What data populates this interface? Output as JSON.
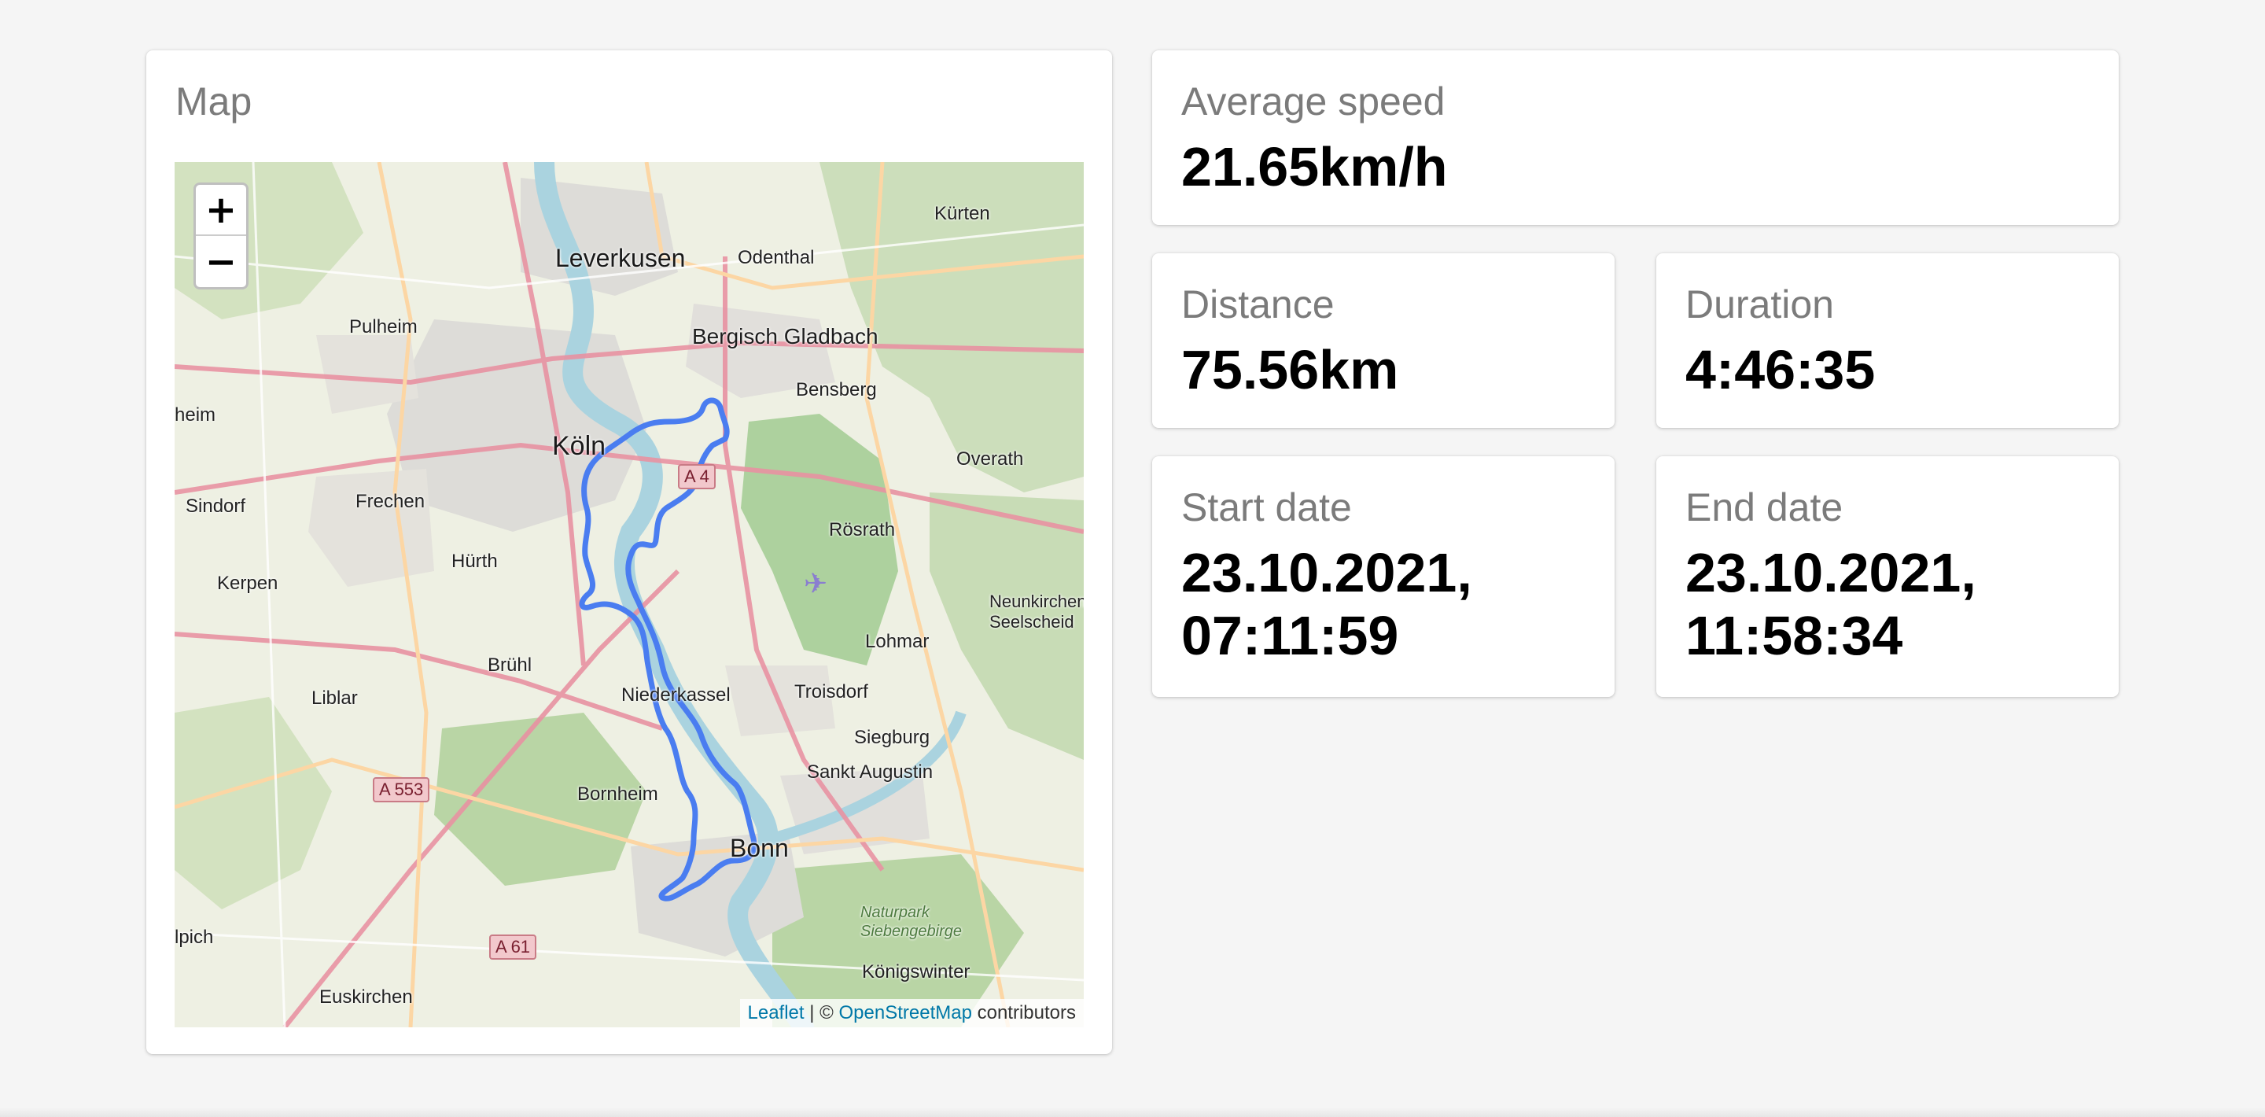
{
  "map_card": {
    "title": "Map",
    "zoom_in": "+",
    "zoom_out": "−",
    "attribution": {
      "leaflet": "Leaflet",
      "separator": " | © ",
      "osm": "OpenStreetMap",
      "suffix": " contributors"
    },
    "place_labels": [
      "Leverkusen",
      "Odenthal",
      "Kürten",
      "Bergisch Gladbach",
      "Pulheim",
      "Bensberg",
      "Köln",
      "Overath",
      "Sindorf",
      "Frechen",
      "Rösrath",
      "Hürth",
      "Kerpen",
      "Neunkirchen-Seelscheid",
      "Lohmar",
      "Brühl",
      "Niederkassel",
      "Troisdorf",
      "Liblar",
      "Siegburg",
      "Sankt Augustin",
      "Bornheim",
      "Bonn",
      "Naturpark Siebengebirge",
      "Königswinter",
      "Euskirchen",
      "heim",
      "lpich"
    ],
    "road_shields": [
      "A 4",
      "A 553",
      "A 61"
    ],
    "colors": {
      "route": "#4a7df0",
      "water": "#aad3df",
      "forest": "#add19e",
      "urban": "#dddcd8"
    }
  },
  "stats": {
    "average_speed": {
      "label": "Average speed",
      "value": "21.65km/h"
    },
    "distance": {
      "label": "Distance",
      "value": "75.56km"
    },
    "duration": {
      "label": "Duration",
      "value": "4:46:35"
    },
    "start_date": {
      "label": "Start date",
      "value_line1": "23.10.2021,",
      "value_line2": "07:11:59"
    },
    "end_date": {
      "label": "End date",
      "value_line1": "23.10.2021,",
      "value_line2": "11:58:34"
    }
  }
}
